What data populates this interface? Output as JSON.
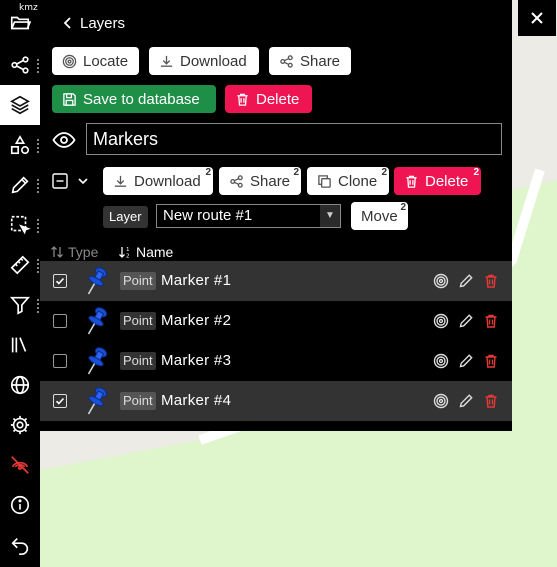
{
  "map": {
    "land_color": "#dff5cc",
    "road_color": "#ffffff",
    "bg_color": "#ecebe6"
  },
  "toolbar": {
    "kmz_badge": "kmz",
    "items": [
      {
        "name": "open-folder-icon",
        "active": false
      },
      {
        "name": "share-icon",
        "active": false
      },
      {
        "name": "layers-icon",
        "active": true
      },
      {
        "name": "shapes-icon",
        "active": false
      },
      {
        "name": "pencil-icon",
        "active": false
      },
      {
        "name": "selection-icon",
        "active": false
      },
      {
        "name": "ruler-icon",
        "active": false
      },
      {
        "name": "filter-icon",
        "active": false
      },
      {
        "name": "library-icon",
        "active": false
      },
      {
        "name": "globe-icon",
        "active": false
      },
      {
        "name": "gear-icon",
        "active": false
      },
      {
        "name": "location-off-icon",
        "active": false
      },
      {
        "name": "info-icon",
        "active": false
      },
      {
        "name": "undo-icon",
        "active": false
      }
    ]
  },
  "panel": {
    "back_label": "Layers",
    "buttons": {
      "locate": "Locate",
      "download": "Download",
      "share": "Share",
      "save_to_database": "Save to database",
      "delete": "Delete"
    },
    "layer_name": "Markers",
    "selection_actions": {
      "download": "Download",
      "share": "Share",
      "clone": "Clone",
      "delete": "Delete",
      "count": "2"
    },
    "layer_tag": "Layer",
    "route_select": {
      "value": "New route #1"
    },
    "move_label": "Move",
    "columns": {
      "type": "Type",
      "name": "Name"
    },
    "rows": [
      {
        "checked": true,
        "type": "Point",
        "name": "Marker #1"
      },
      {
        "checked": false,
        "type": "Point",
        "name": "Marker #2"
      },
      {
        "checked": false,
        "type": "Point",
        "name": "Marker #3"
      },
      {
        "checked": true,
        "type": "Point",
        "name": "Marker #4"
      }
    ]
  },
  "colors": {
    "green": "#1f8f48",
    "red": "#ef1553",
    "delete_icon": "#e53935",
    "pin_blue": "#1a4fd6"
  }
}
